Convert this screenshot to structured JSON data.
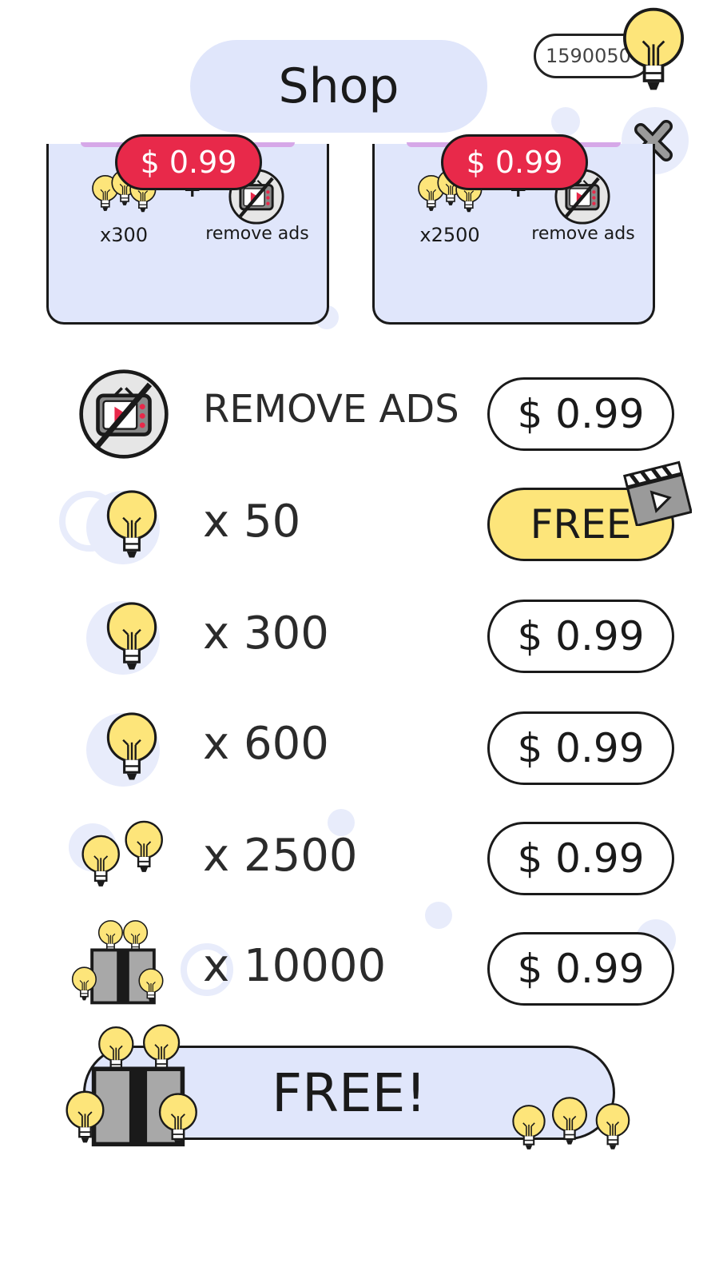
{
  "header": {
    "title": "Shop",
    "currency_amount": "1590050",
    "currency_icon": "lightbulb-icon",
    "close_icon": "close-icon"
  },
  "bundles": [
    {
      "bulb_caption": "x300",
      "ads_caption": "remove ads",
      "price": "$ 0.99",
      "plus": "+"
    },
    {
      "bulb_caption": "x2500",
      "ads_caption": "remove ads",
      "price": "$ 0.99",
      "plus": "+"
    }
  ],
  "rows": [
    {
      "label": "REMOVE ADS",
      "price": "$ 0.99",
      "icon": "no-ads-tv-icon"
    },
    {
      "label": "x 50",
      "price": "FREE",
      "icon": "lightbulb-icon",
      "badge_icon": "clapperboard-icon"
    },
    {
      "label": "x 300",
      "price": "$ 0.99",
      "icon": "lightbulb-icon"
    },
    {
      "label": "x 600",
      "price": "$ 0.99",
      "icon": "lightbulb-icon"
    },
    {
      "label": "x 2500",
      "price": "$ 0.99",
      "icon": "two-lightbulbs-icon"
    },
    {
      "label": "x 10000",
      "price": "$ 0.99",
      "icon": "gift-box-bulbs-icon"
    }
  ],
  "free_banner": {
    "label": "FREE!",
    "icon": "gift-box-bulbs-icon"
  },
  "colors": {
    "accent_red": "#e8294a",
    "bulb_yellow": "#fde57a",
    "panel_blue": "#e0e6fb"
  }
}
